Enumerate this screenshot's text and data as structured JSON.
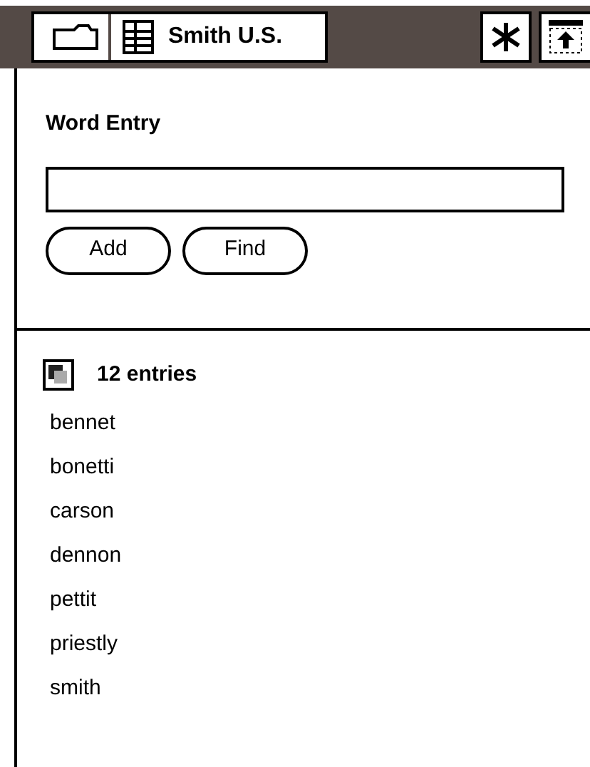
{
  "toolbar": {
    "title": "Smith U.S."
  },
  "entry": {
    "heading": "Word Entry",
    "buttons": [
      "Add",
      "Find"
    ]
  },
  "list": {
    "count": "12 entries",
    "items": [
      "bennet",
      "bonetti",
      "carson",
      "dennon",
      "pettit",
      "priestly",
      "smith"
    ]
  }
}
